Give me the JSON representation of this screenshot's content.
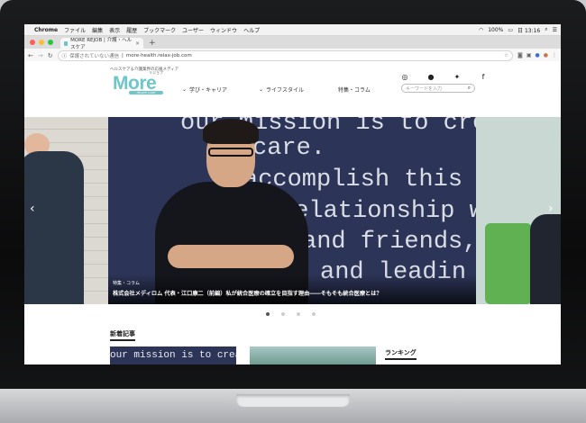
{
  "menubar": {
    "apple": "",
    "app": "Chrome",
    "items": [
      "ファイル",
      "編集",
      "表示",
      "履歴",
      "ブックマーク",
      "ユーザー",
      "ウィンドウ",
      "ヘルプ"
    ],
    "battery": "100%",
    "date": "日 13:16"
  },
  "browser": {
    "tab_title": "MORE REJOB | 介護・ヘルスケア",
    "omnibox_security": "保護されていない通信",
    "omnibox_url": "more-health.relax-job.com"
  },
  "site": {
    "tagline": "ヘルスケア＆介護業界の応援メディア",
    "logo": "More",
    "logo_ruby": "リジョブ",
    "logo_sub": "HEALTH CARE",
    "nav": [
      {
        "label": "学び・キャリア",
        "chevron": "⌄"
      },
      {
        "label": "ライフスタイル",
        "chevron": "⌄"
      },
      {
        "label": "特集・コラム",
        "chevron": ""
      }
    ],
    "search_placeholder": "キーワードを入力"
  },
  "hero": {
    "board_lines": [
      "our mission is to crea",
      "care.",
      "accomplish this mi",
      "relationship wit",
      "and friends, c",
      "and leadin"
    ],
    "caption_category": "特集・コラム",
    "caption_title": "株式会社メディロム  代表・江口康二（前編）私が統合医療の確立を目指す理由――そもそも統合医療とは？",
    "dots": 4,
    "active_dot": 0
  },
  "sections": {
    "new_articles": "新着記事",
    "ranking": "ランキング",
    "thumb_text": "our mission is to crea"
  },
  "colors": {
    "brand": "#6ec6c9",
    "board": "#2c3457"
  }
}
